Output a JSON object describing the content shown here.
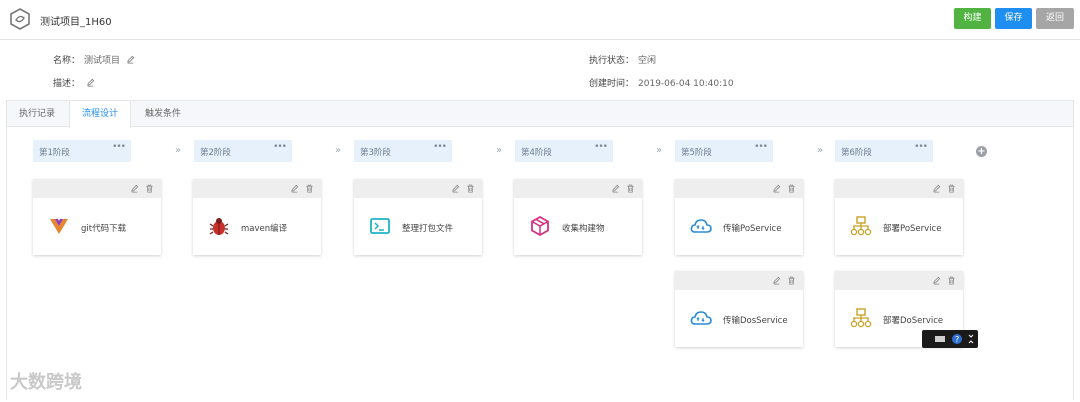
{
  "header": {
    "title": "测试项目_1H60",
    "buttons": {
      "build": "构建",
      "save": "保存",
      "back": "返回"
    }
  },
  "info": {
    "name_label": "名称：",
    "name_value": "测试项目",
    "desc_label": "描述：",
    "status_label": "执行状态：",
    "status_value": "空闲",
    "created_label": "创建时间：",
    "created_value": "2019-06-04 10:40:10"
  },
  "tabs": [
    "执行记录",
    "流程设计",
    "触发条件"
  ],
  "stages": [
    {
      "label": "第1阶段",
      "more": "•••"
    },
    {
      "label": "第2阶段",
      "more": "•••"
    },
    {
      "label": "第3阶段",
      "more": "•••"
    },
    {
      "label": "第4阶段",
      "more": "•••"
    },
    {
      "label": "第5阶段",
      "more": "•••"
    },
    {
      "label": "第6阶段",
      "more": "•••"
    }
  ],
  "chevron": "»",
  "add_symbol": "+",
  "tasks": [
    {
      "name": "git代码下载",
      "icon": "vue-icon"
    },
    {
      "name": "maven编译",
      "icon": "bug-icon"
    },
    {
      "name": "整理打包文件",
      "icon": "terminal-icon"
    },
    {
      "name": "收集构建物",
      "icon": "box-icon"
    },
    {
      "name": "传输PoService",
      "icon": "cloud-upload-icon"
    },
    {
      "name": "部署PoService",
      "icon": "deploy-icon"
    },
    {
      "name": "传输DosService",
      "icon": "cloud-upload-icon"
    },
    {
      "name": "部署DoService",
      "icon": "deploy-icon"
    }
  ],
  "watermark": "大数跨境",
  "colors": {
    "build": "#52b343",
    "save": "#1f8ef1",
    "back": "#a6a6a6",
    "accent": "#1f8ef1"
  }
}
